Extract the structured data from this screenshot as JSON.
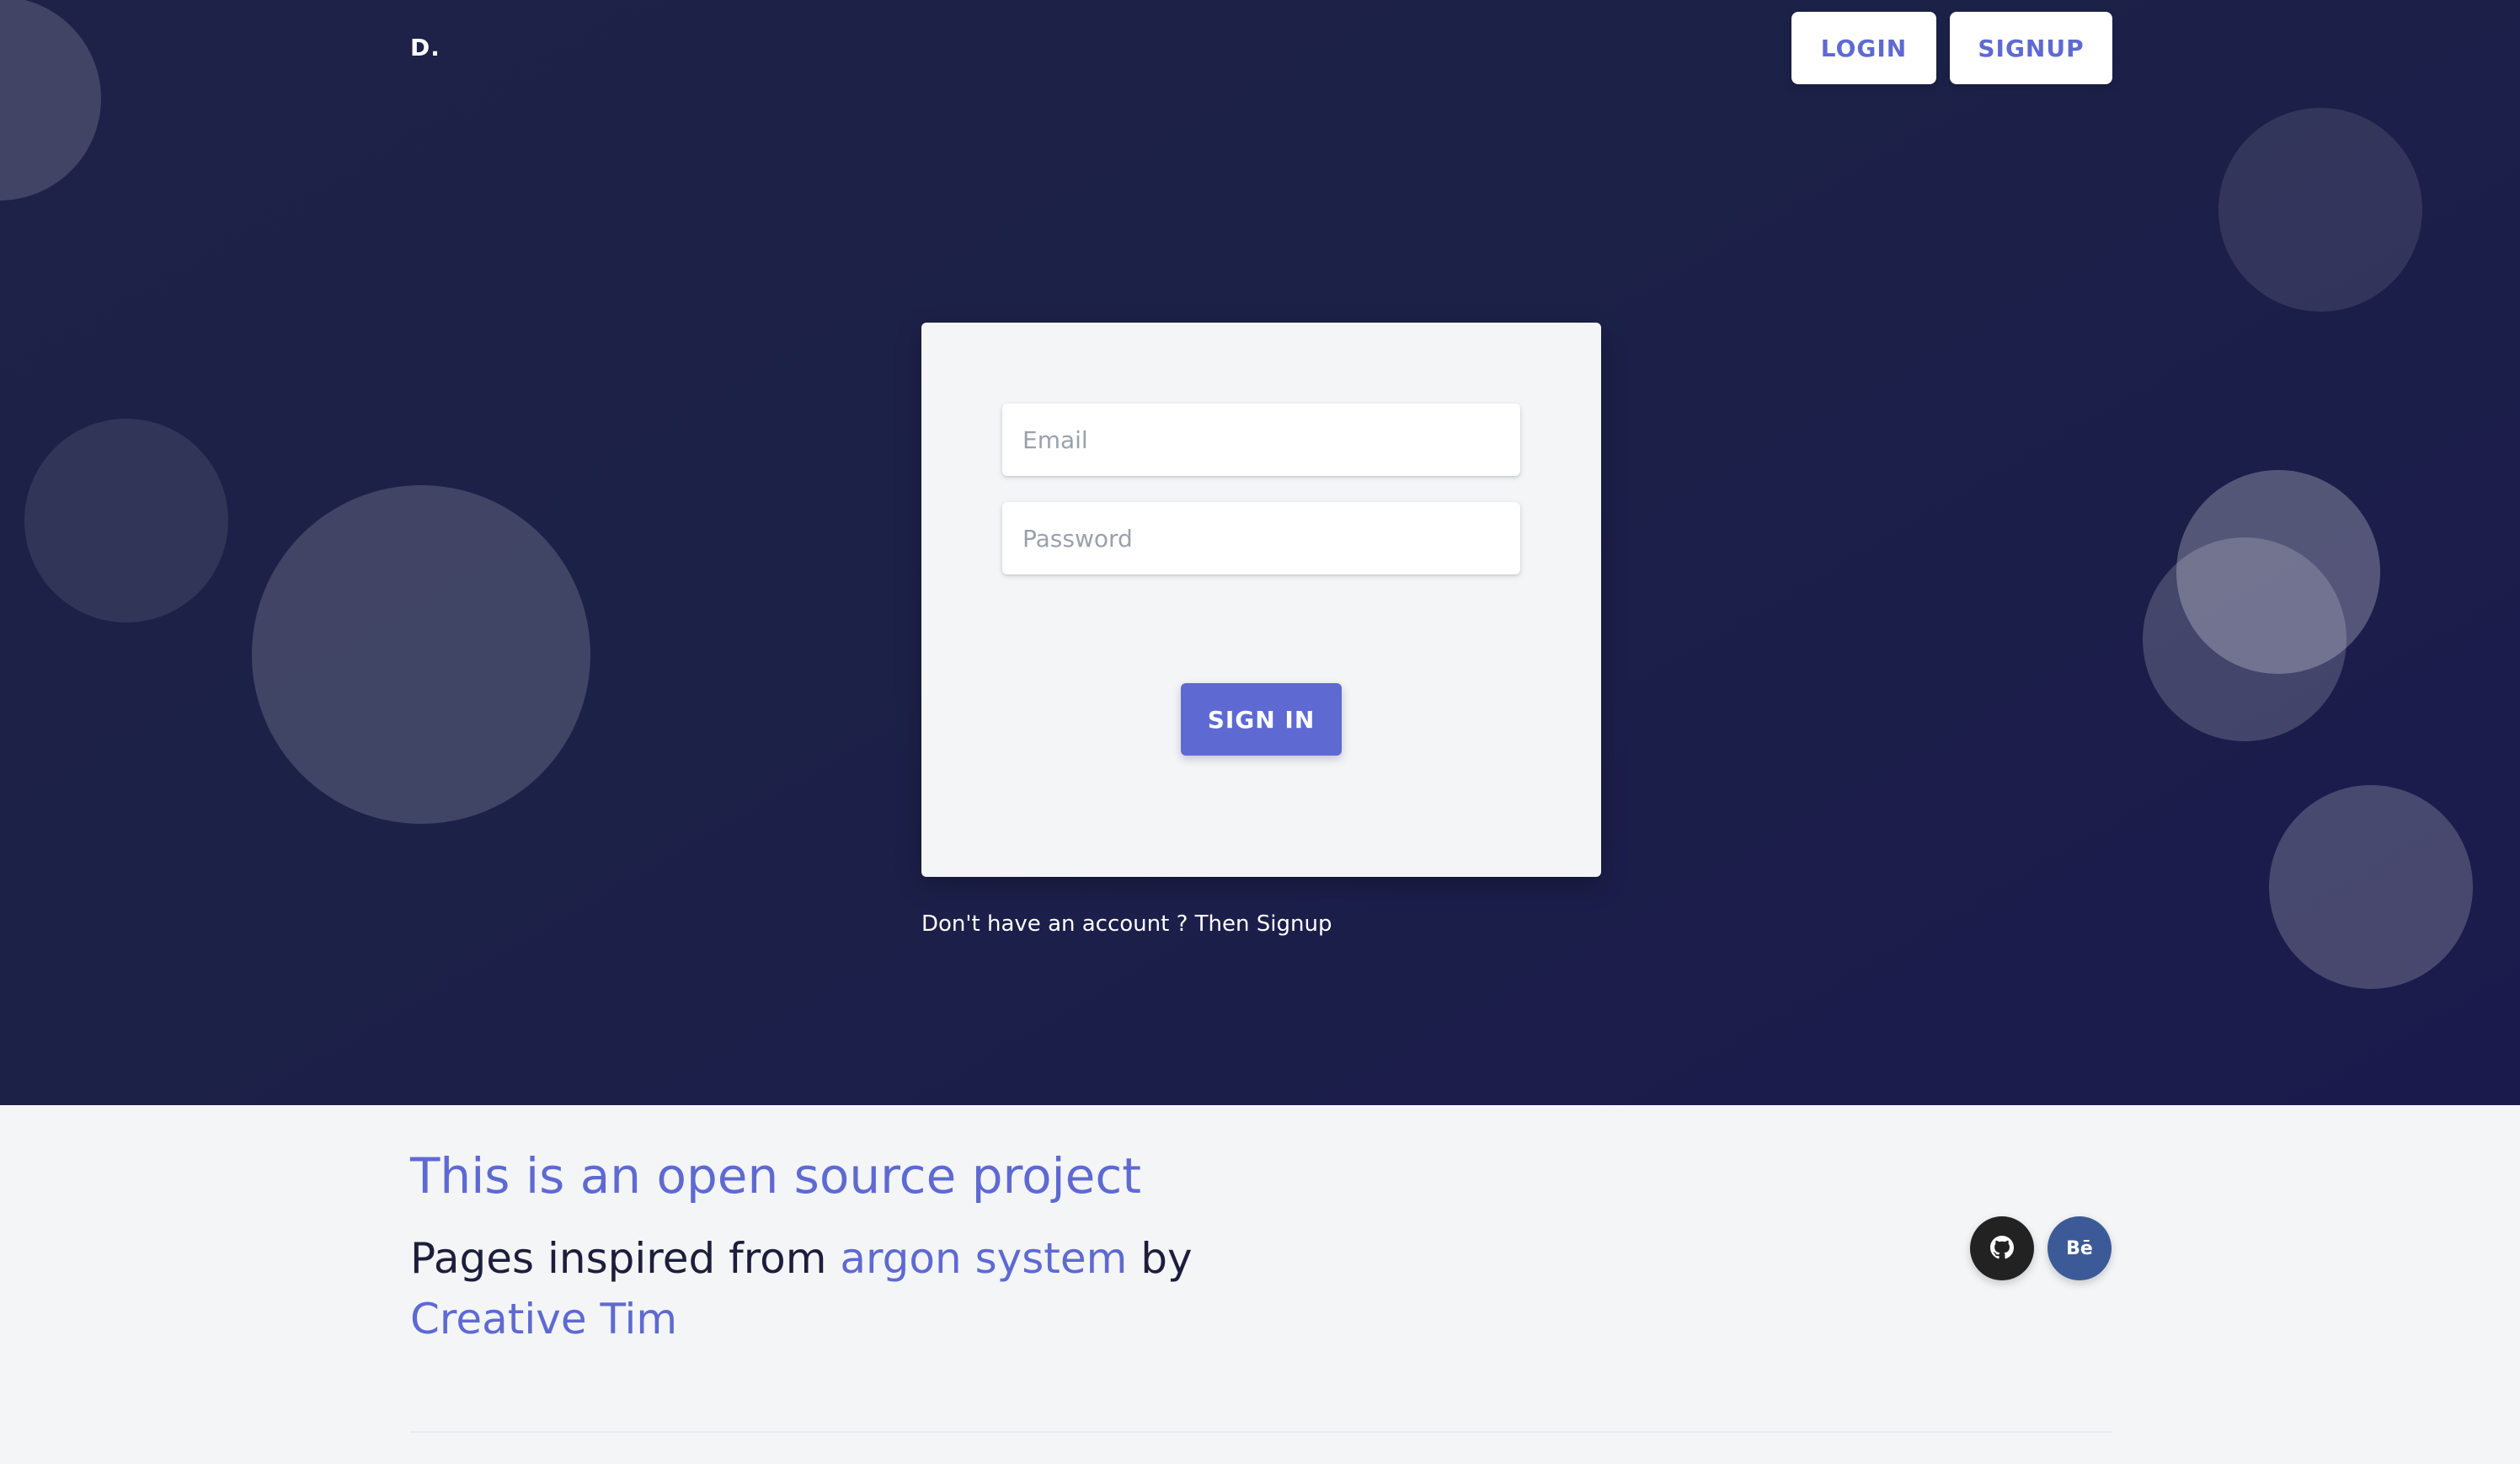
{
  "header": {
    "brand": "D.",
    "login_label": "LOGIN",
    "signup_label": "SIGNUP"
  },
  "login_form": {
    "email_placeholder": "Email",
    "password_placeholder": "Password",
    "submit_label": "SIGN IN"
  },
  "signup_hint": "Don't have an account ? Then Signup",
  "footer": {
    "title": "This is an open source project",
    "subtitle_prefix": "Pages inspired from ",
    "subtitle_link_argon": "argon system",
    "subtitle_by": " by",
    "subtitle_link_creative": "Creative Tim",
    "social": [
      {
        "icon": "github-icon",
        "label": ""
      },
      {
        "icon": "behance-icon",
        "label": "Bē"
      }
    ]
  },
  "colors": {
    "accent": "#5e6ad2",
    "hero_bg": "#1e2148",
    "footer_bg": "#f4f5f7",
    "github_bg": "#222222",
    "behance_bg": "#3d5a98"
  }
}
